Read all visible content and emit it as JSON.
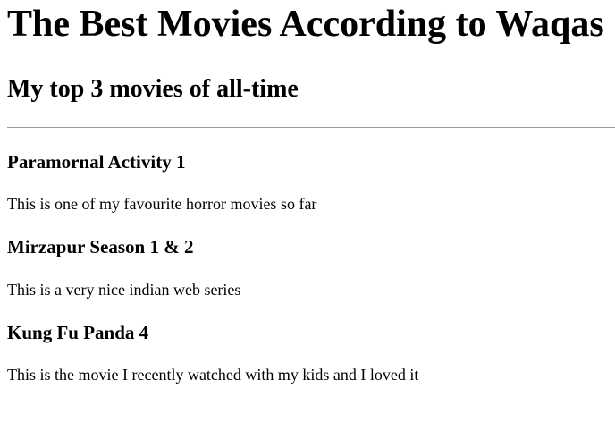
{
  "page": {
    "title": "The Best Movies According to Waqas",
    "subtitle": "My top 3 movies of all-time"
  },
  "movies": [
    {
      "title": "Paramornal Activity 1",
      "description": "This is one of my favourite horror movies so far"
    },
    {
      "title": "Mirzapur Season 1 & 2",
      "description": "This is a very nice indian web series"
    },
    {
      "title": "Kung Fu Panda 4",
      "description": "This is the movie I recently watched with my kids and I loved it"
    }
  ]
}
